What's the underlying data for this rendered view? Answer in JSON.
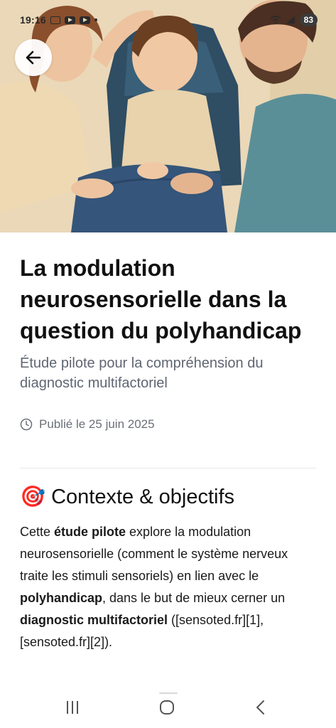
{
  "status_bar": {
    "time": "19:16",
    "battery": "83",
    "icons": [
      "gallery-icon",
      "youtube-icon",
      "youtube-icon",
      "dot-icon",
      "wifi-icon",
      "signal-icon"
    ]
  },
  "hero": {
    "image": "illustration-family-child-wheelchair"
  },
  "back_button": {
    "icon": "arrow-left-icon"
  },
  "article": {
    "title": "La modulation neurosensorielle dans la question du polyhandicap",
    "subtitle": "Étude pilote pour la compréhension du diagnostic multifactoriel",
    "published": "Publié le 25 juin 2025",
    "section": {
      "emoji": "🎯",
      "title": "Contexte & objectifs",
      "paragraph": [
        {
          "text": "Cette ",
          "bold": false
        },
        {
          "text": "étude pilote",
          "bold": true
        },
        {
          "text": " explore la modulation neurosensorielle (comment le système nerveux traite les stimuli sensoriels) en lien avec le ",
          "bold": false
        },
        {
          "text": "polyhandicap",
          "bold": true
        },
        {
          "text": ", dans le but de mieux cerner un ",
          "bold": false
        },
        {
          "text": "diagnostic multifactoriel",
          "bold": true
        },
        {
          "text": " ([sensoted.fr][1], [sensoted.fr][2]).",
          "bold": false
        }
      ]
    }
  },
  "nav_bar": {
    "buttons": [
      "recents-icon",
      "home-icon",
      "back-icon"
    ]
  },
  "colors": {
    "title": "#111111",
    "subtitle": "#5f6672",
    "meta": "#6b6f76",
    "hero_bg": "#e9d9be"
  }
}
